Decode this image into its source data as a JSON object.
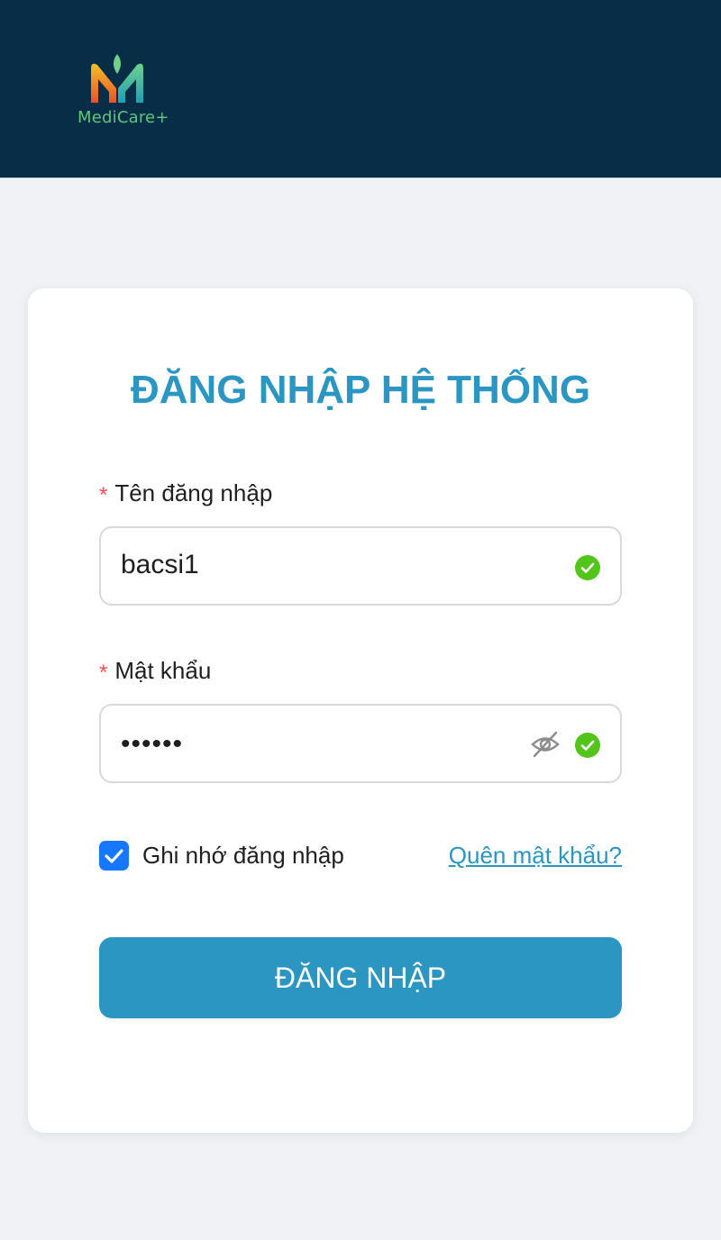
{
  "brand": {
    "name": "MediCare+",
    "logo_icon": "leaf-m-logo-icon",
    "colors": {
      "header_bg": "#072e46",
      "accent": "#2b96c2",
      "success": "#52c41a",
      "checkbox": "#1677ff"
    }
  },
  "form": {
    "title": "ĐĂNG NHẬP HỆ THỐNG",
    "required_mark": "*",
    "username": {
      "label": "Tên đăng nhập",
      "value": "bacsi1",
      "status_icon": "check-circle-icon"
    },
    "password": {
      "label": "Mật khẩu",
      "value": "••••••",
      "toggle_icon": "eye-off-icon",
      "status_icon": "check-circle-icon"
    },
    "remember": {
      "label": "Ghi nhớ đăng nhập",
      "checked": true
    },
    "forgot_link": "Quên mật khẩu?",
    "submit_label": "ĐĂNG NHẬP"
  }
}
